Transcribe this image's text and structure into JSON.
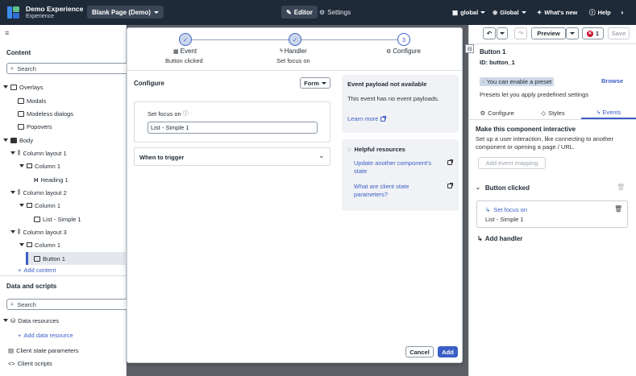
{
  "topbar": {
    "app_title": "Demo Experience",
    "app_subtitle": "Experience",
    "page_select": "Blank Page (Demo)",
    "editor": "Editor",
    "settings": "Settings",
    "global_scope": "global",
    "global_menu": "Global",
    "whats_new": "What's new",
    "help": "Help",
    "colors": {
      "bar": "#1f2a38",
      "logo_blue": "#3c8cf0",
      "logo_green": "#5fc08a"
    }
  },
  "left_panel": {
    "toolbar_icon": "≡",
    "content_title": "Content",
    "content_search_placeholder": "Search",
    "tree": [
      {
        "label": "Overlays",
        "icon": "overlay-icon"
      },
      {
        "label": "Modals",
        "icon": "modal-icon"
      },
      {
        "label": "Modeless dialogs",
        "icon": "dialog-icon"
      },
      {
        "label": "Popovers",
        "icon": "popover-icon"
      },
      {
        "label": "Body",
        "icon": "body-icon"
      },
      {
        "label": "Column layout 1",
        "icon": "columns-icon"
      },
      {
        "label": "Column 1",
        "icon": "column-icon"
      },
      {
        "label": "Heading 1",
        "icon": "heading-icon"
      },
      {
        "label": "Column layout 2",
        "icon": "columns-icon"
      },
      {
        "label": "Column 1",
        "icon": "column-icon"
      },
      {
        "label": "List - Simple 1",
        "icon": "list-icon"
      },
      {
        "label": "Column layout 3",
        "icon": "columns-icon"
      },
      {
        "label": "Column 1",
        "icon": "column-icon"
      },
      {
        "label": "Button 1",
        "icon": "button-icon"
      }
    ],
    "add_content": "Add content",
    "data_title": "Data and scripts",
    "data_search_placeholder": "Search",
    "data_resources": "Data resources",
    "add_data_resource": "Add data resource",
    "client_state": "Client state parameters",
    "client_scripts": "Client scripts"
  },
  "modal": {
    "steps": [
      {
        "label": "Event",
        "sub": "Button clicked",
        "state": "done",
        "glyph": "✓"
      },
      {
        "label": "Handler",
        "sub": "Set focus on",
        "state": "done",
        "glyph": "✓"
      },
      {
        "label": "Configure",
        "sub": "",
        "state": "current",
        "glyph": "3"
      }
    ],
    "configure_title": "Configure",
    "form_select": "Form",
    "set_focus_label": "Set focus on",
    "set_focus_value": "List - Simple 1",
    "when_to_trigger": "When to trigger",
    "payload_title": "Event payload not available",
    "payload_text": "This event has no event payloads.",
    "learn_more": "Learn more",
    "helpful_title": "Helpful resources",
    "resource_1": "Update another component's state",
    "resource_2": "What are client state parameters?",
    "cancel": "Cancel",
    "add": "Add"
  },
  "right_panel": {
    "preview": "Preview",
    "error_count": "1",
    "save": "Save",
    "component_name": "Button 1",
    "component_id": "ID: button_1",
    "preset_chip": "You can enable a preset",
    "browse": "Browse",
    "preset_desc": "Presets let you apply predefined settings",
    "tabs": [
      "Configure",
      "Styles",
      "Events"
    ],
    "interactive_title": "Make this component interactive",
    "interactive_desc": "Set up a user interaction, like connecting to another component or opening a page / URL.",
    "add_event_mapping": "Add event mapping",
    "event_name": "Button clicked",
    "handler_name": "Set focus on",
    "handler_target": "List - Simple 1",
    "add_handler": "Add handler",
    "colors": {
      "accent": "#3c5fc6",
      "error": "#c8102e"
    }
  }
}
